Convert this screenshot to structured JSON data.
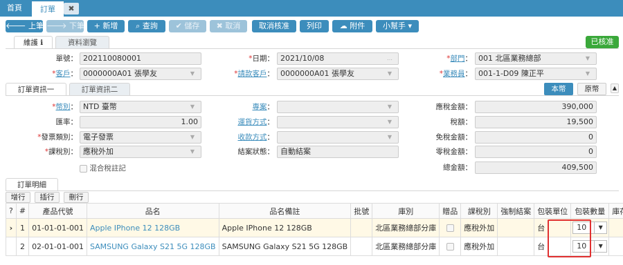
{
  "tabs": {
    "home": "首頁",
    "order": "訂單",
    "close": "✖"
  },
  "toolbar": {
    "prev": "上筆",
    "next": "下筆",
    "new": "新增",
    "query": "查詢",
    "save": "儲存",
    "cancel": "取消",
    "cancel_approve": "取消核准",
    "print": "列印",
    "attach": "附件",
    "helper": "小幫手"
  },
  "status_badge": "已核准",
  "form_tabs": {
    "maintain": "維護",
    "browse": "資料瀏覽"
  },
  "fields": {
    "order_no": {
      "label": "單號：",
      "value": "202110080001"
    },
    "date": {
      "label": "日期：",
      "value": "2021/10/08"
    },
    "dept": {
      "label": "部門",
      "value": "001 北區業務總部"
    },
    "customer": {
      "label": "客戶",
      "value": "0000000A01 張學友"
    },
    "bill_customer": {
      "label": "請款客戶",
      "value": "0000000A01 張學友"
    },
    "salesman": {
      "label": "業務員",
      "value": "001-1-D09 陳正平"
    }
  },
  "info_tabs": {
    "one": "訂單資訊一",
    "two": "訂單資訊二"
  },
  "currency_toggle": {
    "local": "本幣",
    "original": "原幣"
  },
  "info": {
    "currency": {
      "label": "幣別",
      "value": "NTD 臺幣"
    },
    "rate": {
      "label": "匯率：",
      "value": "1.00"
    },
    "invoice_type": {
      "label": "發票類別：",
      "value": "電子發票"
    },
    "tax_type": {
      "label": "課稅別：",
      "value": "應稅外加"
    },
    "mixed_tax": "混合稅註記",
    "project": {
      "label": "專案",
      "value": ""
    },
    "shipping": {
      "label": "運貨方式",
      "value": ""
    },
    "payment": {
      "label": "收款方式",
      "value": ""
    },
    "close_status": {
      "label": "結案狀態：",
      "value": "自動結案"
    },
    "taxable": {
      "label": "應稅金額：",
      "value": "390,000"
    },
    "tax": {
      "label": "稅額：",
      "value": "19,500"
    },
    "exempt": {
      "label": "免稅金額：",
      "value": "0"
    },
    "zero": {
      "label": "零稅金額：",
      "value": "0"
    },
    "total": {
      "label": "總金額：",
      "value": "409,500"
    }
  },
  "detail_tab": "訂單明細",
  "row_buttons": {
    "add": "增行",
    "insert": "插行",
    "delete": "刪行"
  },
  "grid": {
    "headers": [
      "?",
      "#",
      "產品代號",
      "品名",
      "品名備註",
      "批號",
      "庫別",
      "贈品",
      "課稅別",
      "強制結案",
      "包裝單位",
      "包裝數量",
      "庫存單位"
    ],
    "rows": [
      {
        "no": "1",
        "code": "01-01-01-001",
        "name": "Apple IPhone 12 128GB",
        "remark": "Apple IPhone 12 128GB",
        "batch": "",
        "warehouse": "北區業務總部分庫",
        "tax": "應稅外加",
        "unit": "台",
        "qty": "10"
      },
      {
        "no": "2",
        "code": "02-01-01-001",
        "name": "SAMSUNG Galaxy S21 5G 128GB",
        "remark": "SAMSUNG Galaxy S21 5G 128GB",
        "batch": "",
        "warehouse": "北區業務總部分庫",
        "tax": "應稅外加",
        "unit": "台",
        "qty": "10"
      }
    ]
  },
  "colors": {
    "primary": "#3c8dbc",
    "approved": "#3aa83a",
    "highlight": "#e03030"
  }
}
